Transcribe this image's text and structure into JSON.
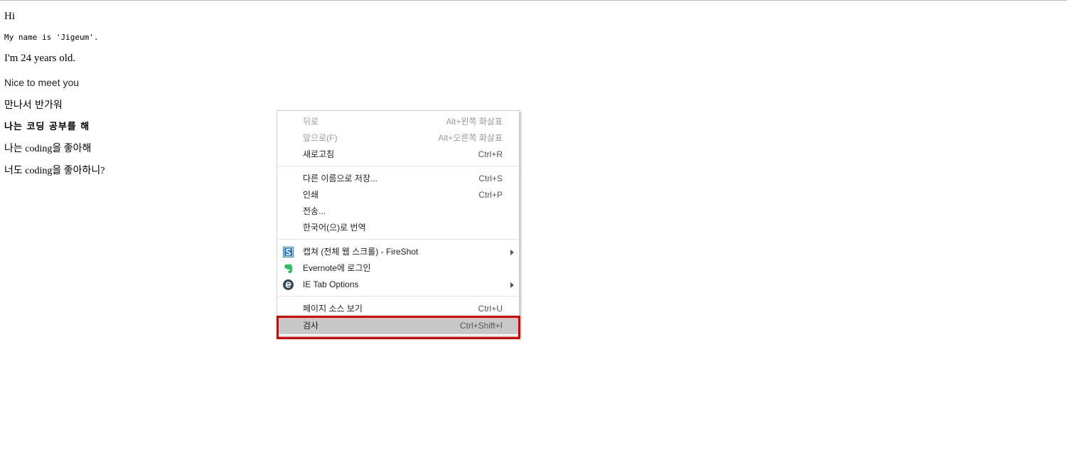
{
  "page": {
    "lines": [
      "Hi",
      "My name is 'Jigeum'.",
      "I'm 24 years old.",
      "Nice to meet you",
      "만나서 반가워",
      "나는 코딩 공부를 해",
      "나는 coding을 좋아해",
      "너도 coding을 좋아하니?"
    ]
  },
  "context_menu": {
    "items": [
      {
        "label": "뒤로",
        "shortcut": "Alt+왼쪽 화살표",
        "disabled": true
      },
      {
        "label": "앞으로(F)",
        "shortcut": "Alt+오른쪽 화살표",
        "disabled": true
      },
      {
        "label": "새로고침",
        "shortcut": "Ctrl+R"
      },
      {
        "label": "다른 이름으로 저장...",
        "shortcut": "Ctrl+S"
      },
      {
        "label": "인쇄",
        "shortcut": "Ctrl+P"
      },
      {
        "label": "전송...",
        "shortcut": ""
      },
      {
        "label": "한국어(으)로 번역",
        "shortcut": ""
      },
      {
        "label": "캡쳐 (전체 웹 스크롤) - FireShot",
        "icon": "fireshot-icon",
        "submenu": true
      },
      {
        "label": "Evernote에 로그인",
        "icon": "evernote-icon"
      },
      {
        "label": "IE Tab Options",
        "icon": "ie-tab-icon",
        "submenu": true
      },
      {
        "label": "페이지 소스 보기",
        "shortcut": "Ctrl+U"
      },
      {
        "label": "검사",
        "shortcut": "Ctrl+Shift+I",
        "highlighted": true
      }
    ]
  },
  "colors": {
    "highlight_box": "#e00000",
    "hover_row": "#c8c8c8",
    "fireshot": "#2c7bc0",
    "evernote": "#2dbe60",
    "ie_tab": "#34495e"
  }
}
